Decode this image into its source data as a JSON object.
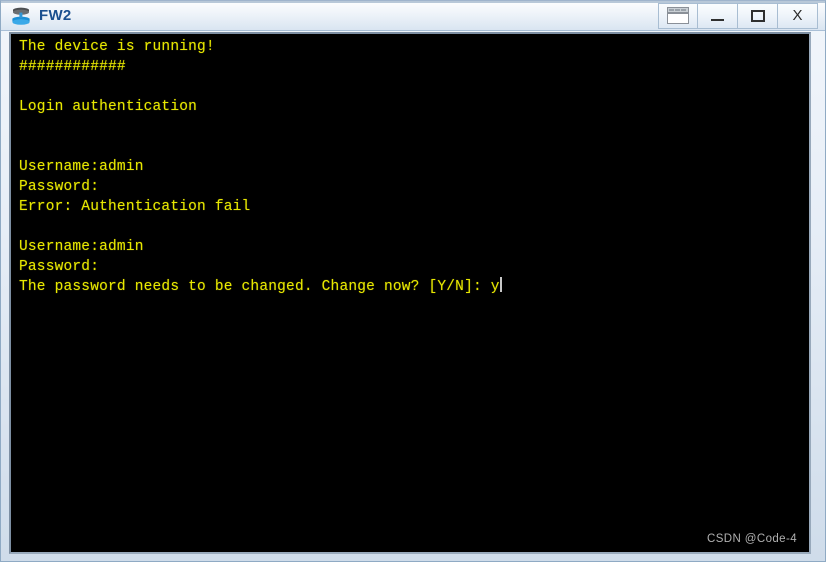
{
  "window": {
    "title": "FW2",
    "icon": "firewall-device-icon",
    "controls": [
      {
        "name": "panel-toggle-button",
        "label": ""
      },
      {
        "name": "minimize-button",
        "label": ""
      },
      {
        "name": "maximize-button",
        "label": ""
      },
      {
        "name": "close-button",
        "label": "X"
      }
    ]
  },
  "terminal": {
    "background_color": "#000000",
    "text_color": "#e8e800",
    "cursor_color": "#c8c8c8",
    "lines": [
      "The device is running!",
      "############",
      "",
      "Login authentication",
      "",
      "",
      "Username:admin",
      "Password:",
      "Error: Authentication fail",
      "",
      "Username:admin",
      "Password:",
      "The password needs to be changed. Change now? [Y/N]: y"
    ],
    "cursor_line_index": 12
  },
  "watermark": {
    "text": "CSDN @Code-4"
  }
}
